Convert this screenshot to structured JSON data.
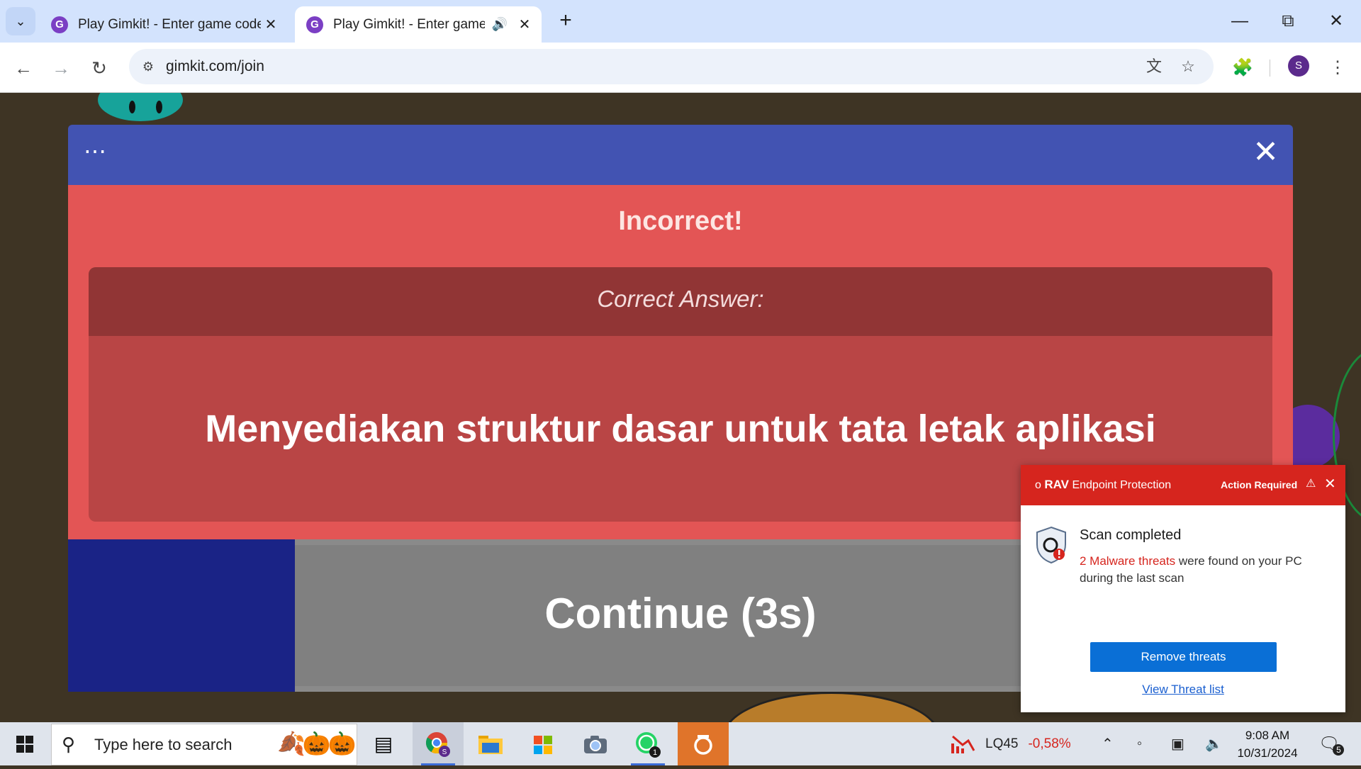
{
  "browser": {
    "tabs": [
      {
        "title": "Play Gimkit! - Enter game code",
        "active": false,
        "favicon": "G"
      },
      {
        "title": "Play Gimkit! - Enter game co",
        "active": true,
        "favicon": "G"
      }
    ],
    "url": "gimkit.com/join",
    "profile_initial": "S"
  },
  "modal": {
    "result_title": "Incorrect!",
    "correct_answer_label": "Correct Answer:",
    "correct_answer": "Menyediakan struktur dasar untuk tata letak aplikasi",
    "continue_label": "Continue (3s)",
    "continue_progress": 0.185
  },
  "notification": {
    "brand": "RAV",
    "product": "Endpoint Protection",
    "action": "Action Required",
    "title": "Scan completed",
    "threat_highlight": "2 Malware threats",
    "threat_message": "were found on your PC during the last scan",
    "primary_button": "Remove threats",
    "link": "View Threat list"
  },
  "taskbar": {
    "search_placeholder": "Type here to search",
    "whatsapp_badge": "1",
    "chrome_badge": "S",
    "stock_symbol": "LQ45",
    "stock_change": "-0,58%",
    "time": "9:08 AM",
    "date": "10/31/2024",
    "notification_count": "5"
  },
  "colors": {
    "modal_header": "#4253b2",
    "incorrect_bg": "#e35555",
    "answer_box": "#b94545",
    "continue_fill": "#1a2386",
    "rav_red": "#d6251e",
    "button_blue": "#0a6fd6"
  }
}
